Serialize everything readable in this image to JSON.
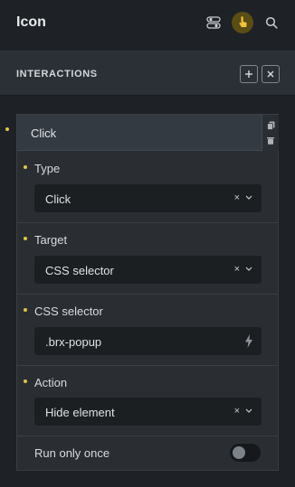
{
  "panel": {
    "title": "Icon"
  },
  "top_icons": [
    "toggle-icon",
    "interaction-hand-icon",
    "search-icon"
  ],
  "section": {
    "title": "INTERACTIONS",
    "add_icon": "plus-icon",
    "close_icon": "close-icon"
  },
  "interaction": {
    "trigger_label": "Click",
    "side_icons": [
      "copy-icon",
      "trash-icon"
    ],
    "fields": {
      "type": {
        "label": "Type",
        "value": "Click"
      },
      "target": {
        "label": "Target",
        "value": "CSS selector"
      },
      "selector": {
        "label": "CSS selector",
        "value": ".brx-popup",
        "icon": "bolt-icon"
      },
      "action": {
        "label": "Action",
        "value": "Hide element"
      },
      "run_once": {
        "label": "Run only once",
        "enabled": false
      }
    },
    "clear_glyph": "×"
  },
  "colors": {
    "accent": "#e0c64a",
    "background": "#1e2125",
    "card": "#2a2e33",
    "input": "#1c1f22"
  }
}
